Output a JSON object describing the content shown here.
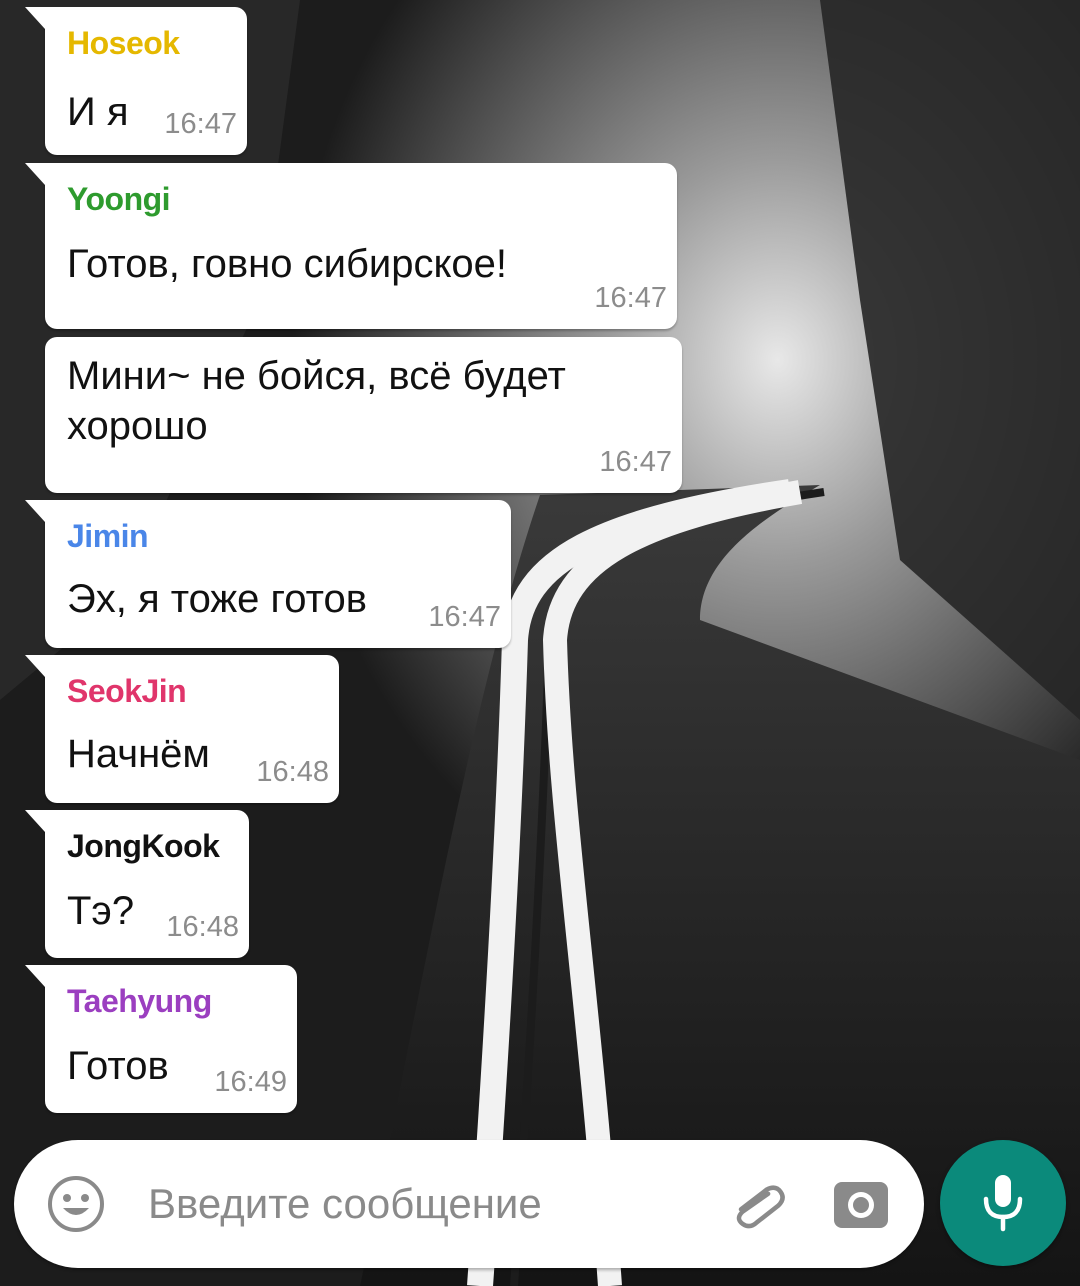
{
  "messages": [
    {
      "sender": "Hoseok",
      "sender_color": "#e5b800",
      "lines": [
        "И я"
      ],
      "time": "16:47"
    },
    {
      "sender": "Yoongi",
      "sender_color": "#2e9b2e",
      "lines": [
        "Готов, говно сибирское!"
      ],
      "time": "16:47"
    },
    {
      "sender": "",
      "sender_color": "",
      "lines": [
        "Мини~ не бойся, всё будет",
        "хорошо"
      ],
      "time": "16:47"
    },
    {
      "sender": "Jimin",
      "sender_color": "#4a86e8",
      "lines": [
        "Эх, я тоже готов"
      ],
      "time": "16:47"
    },
    {
      "sender": "SeokJin",
      "sender_color": "#e0356b",
      "lines": [
        "Начнём"
      ],
      "time": "16:48"
    },
    {
      "sender": "JongKook",
      "sender_color": "#111111",
      "lines": [
        "Тэ?"
      ],
      "time": "16:48"
    },
    {
      "sender": "Taehyung",
      "sender_color": "#9b3fc0",
      "lines": [
        "Готов"
      ],
      "time": "16:49"
    }
  ],
  "composer": {
    "placeholder": "Введите сообщение",
    "icons": {
      "emoji": "emoji-icon",
      "attach": "paperclip-icon",
      "camera": "camera-icon",
      "mic": "microphone-icon"
    },
    "accent_color": "#0b8a7b"
  }
}
